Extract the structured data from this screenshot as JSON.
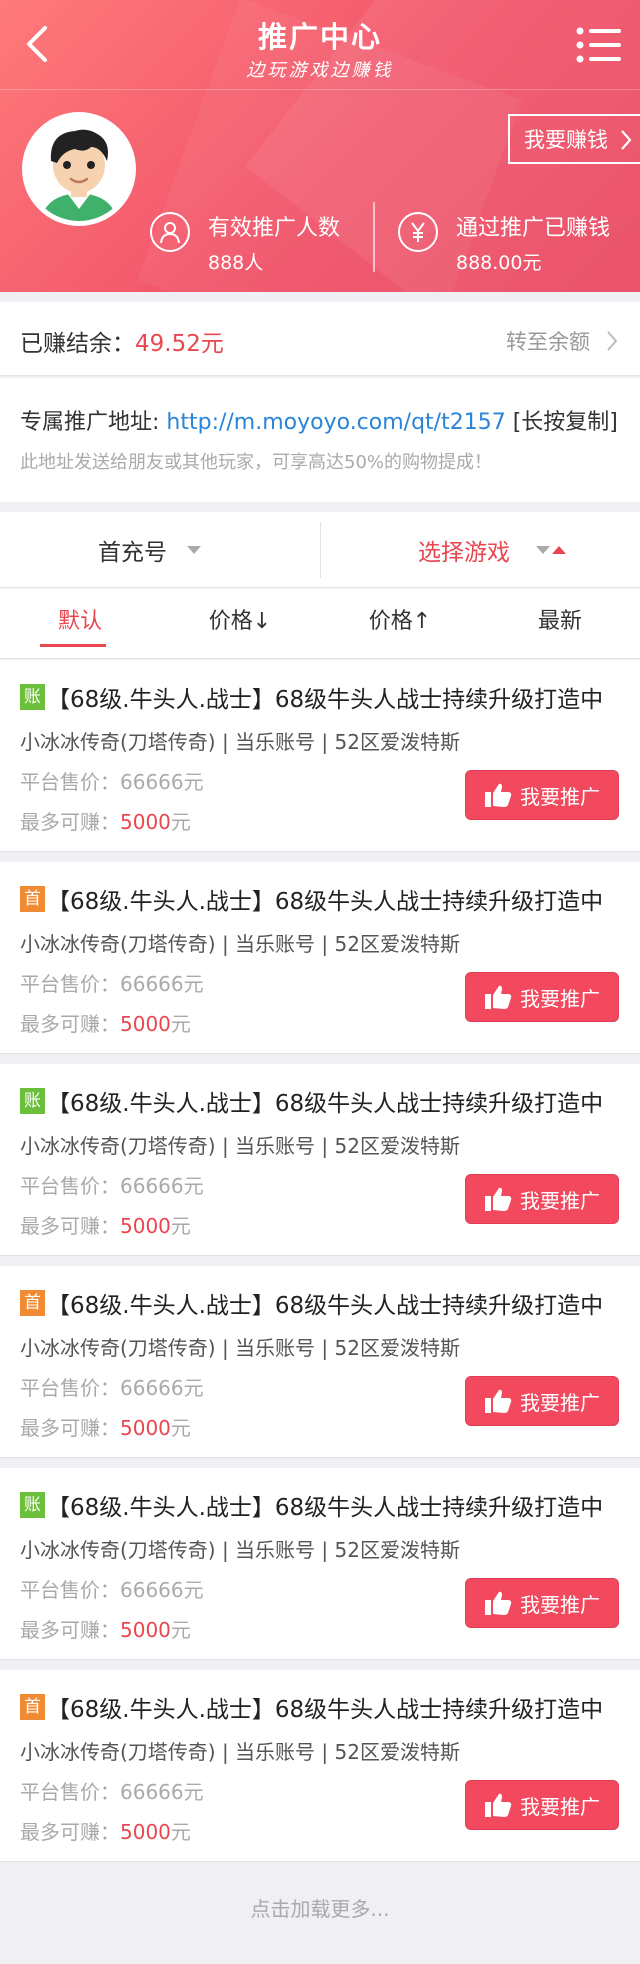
{
  "header": {
    "title": "推广中心",
    "subtitle": "边玩游戏边赚钱",
    "earn_button": "我要赚钱"
  },
  "stats": [
    {
      "label": "有效推广人数",
      "value": "888人",
      "icon": "user-icon"
    },
    {
      "label": "通过推广已赚钱",
      "value": "888.00元",
      "icon": "yuan-icon"
    }
  ],
  "balance": {
    "label": "已赚结余：",
    "value": "49.52元",
    "link": "转至余额"
  },
  "promo": {
    "label": "专属推广地址: ",
    "url": "http://m.moyoyo.com/qt/t2157",
    "copy": " [长按复制]",
    "desc": "此地址发送给朋友或其他玩家，可享高达50%的购物提成！"
  },
  "filters": {
    "left": "首充号",
    "right": "选择游戏"
  },
  "sorts": [
    "默认",
    "价格↓",
    "价格↑",
    "最新"
  ],
  "items": [
    {
      "badge": "账",
      "title": "【68级.牛头人.战士】68级牛头人战士持续升级打造中",
      "sub": "小冰冰传奇(刀塔传奇) | 当乐账号 | 52区爱泼特斯",
      "price_label": "平台售价：",
      "price": "66666元",
      "max_label": "最多可赚：",
      "max_value": "5000",
      "max_unit": "元",
      "button": "我要推广"
    },
    {
      "badge": "首",
      "title": "【68级.牛头人.战士】68级牛头人战士持续升级打造中",
      "sub": "小冰冰传奇(刀塔传奇) | 当乐账号 | 52区爱泼特斯",
      "price_label": "平台售价：",
      "price": "66666元",
      "max_label": "最多可赚：",
      "max_value": "5000",
      "max_unit": "元",
      "button": "我要推广"
    },
    {
      "badge": "账",
      "title": "【68级.牛头人.战士】68级牛头人战士持续升级打造中",
      "sub": "小冰冰传奇(刀塔传奇) | 当乐账号 | 52区爱泼特斯",
      "price_label": "平台售价：",
      "price": "66666元",
      "max_label": "最多可赚：",
      "max_value": "5000",
      "max_unit": "元",
      "button": "我要推广"
    },
    {
      "badge": "首",
      "title": "【68级.牛头人.战士】68级牛头人战士持续升级打造中",
      "sub": "小冰冰传奇(刀塔传奇) | 当乐账号 | 52区爱泼特斯",
      "price_label": "平台售价：",
      "price": "66666元",
      "max_label": "最多可赚：",
      "max_value": "5000",
      "max_unit": "元",
      "button": "我要推广"
    },
    {
      "badge": "账",
      "title": "【68级.牛头人.战士】68级牛头人战士持续升级打造中",
      "sub": "小冰冰传奇(刀塔传奇) | 当乐账号 | 52区爱泼特斯",
      "price_label": "平台售价：",
      "price": "66666元",
      "max_label": "最多可赚：",
      "max_value": "5000",
      "max_unit": "元",
      "button": "我要推广"
    },
    {
      "badge": "首",
      "title": "【68级.牛头人.战士】68级牛头人战士持续升级打造中",
      "sub": "小冰冰传奇(刀塔传奇) | 当乐账号 | 52区爱泼特斯",
      "price_label": "平台售价：",
      "price": "66666元",
      "max_label": "最多可赚：",
      "max_value": "5000",
      "max_unit": "元",
      "button": "我要推广"
    }
  ],
  "load_more": "点击加载更多...",
  "colors": {
    "accent": "#e8474f",
    "header": "#f1546a",
    "link": "#2a84d8",
    "badge_green": "#6cbf3b",
    "badge_orange": "#f08a33"
  }
}
